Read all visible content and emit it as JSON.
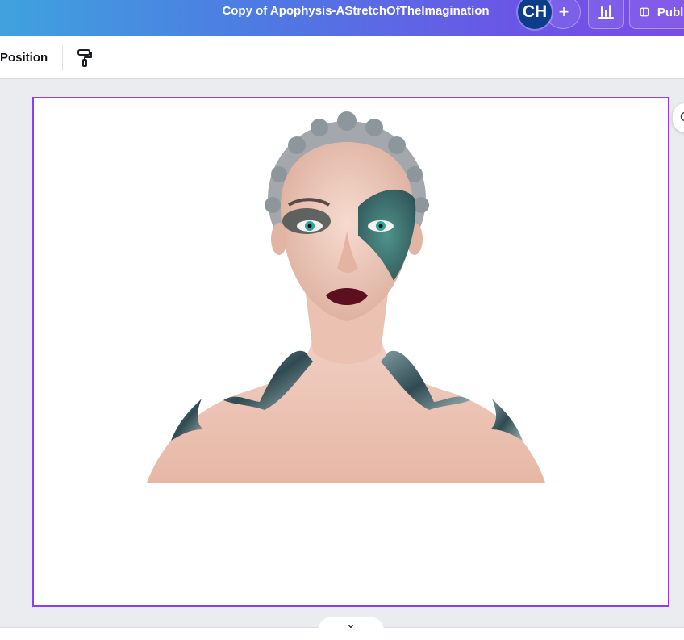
{
  "header": {
    "document_title": "Copy of Apophysis-AStretchOfTheImagination",
    "avatar_initials": "CH",
    "add_label": "+",
    "analytics_icon": "bar-chart-icon",
    "publish_icon": "layout-icon",
    "publish_label": "Publish"
  },
  "toolbar": {
    "position_label": "Position",
    "paint_format_icon": "paint-roller-icon"
  },
  "canvas": {
    "image_alt": "Woman with glittery teal eye makeup, silver braided hair and ornate metal shoulder pieces",
    "selection_color": "#8b3dff",
    "side_handle_glyph": "C"
  },
  "footer": {
    "collapse_icon": "chevron-down-icon",
    "collapse_glyph": "⌄"
  }
}
